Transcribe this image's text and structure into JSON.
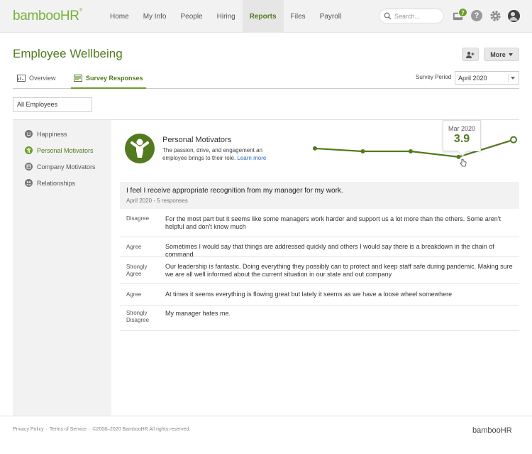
{
  "header": {
    "logo": "bambooHR",
    "nav": [
      "Home",
      "My Info",
      "People",
      "Hiring",
      "Reports",
      "Files",
      "Payroll"
    ],
    "active_nav": "Reports",
    "search_placeholder": "Search...",
    "inbox_count": "7",
    "help_label": "?"
  },
  "page": {
    "title": "Employee Wellbeing",
    "more_label": "More",
    "tabs": [
      {
        "label": "Overview",
        "icon": "chart-icon"
      },
      {
        "label": "Survey Responses",
        "icon": "survey-icon"
      }
    ],
    "active_tab": "Survey Responses",
    "period_label": "Survey Period",
    "period_value": "April 2020",
    "employee_filter": "All Employees"
  },
  "sidebar": {
    "items": [
      {
        "label": "Happiness",
        "icon": "smile-icon"
      },
      {
        "label": "Personal Motivators",
        "icon": "motivator-icon"
      },
      {
        "label": "Company Motivators",
        "icon": "building-icon"
      },
      {
        "label": "Relationships",
        "icon": "people-icon"
      }
    ],
    "active": "Personal Motivators"
  },
  "motivator": {
    "title": "Personal Motivators",
    "description": "The passion, drive, and engagement an employee brings to their role.",
    "link": "Learn more",
    "tooltip_date": "Mar 2020",
    "tooltip_value": "3.9",
    "trend_level": [
      0.62,
      0.5,
      0.5,
      0.27,
      0.98
    ]
  },
  "question": {
    "text": "I feel I receive appropriate recognition from my manager for my work.",
    "meta": "April 2020 - 5 responses"
  },
  "responses": [
    {
      "rating": "Disagree",
      "text": "For the most part but it seems like some managers work harder and support us a lot more than the others. Some aren't helpful and don't know much"
    },
    {
      "rating": "Agree",
      "text": "Sometimes I would say that things are addressed quickly and others I would say there is a breakdown in the chain of command"
    },
    {
      "rating": "Strongly Agree",
      "text": "Our leadership is fantastic. Doing everything they possibly can to protect and keep staff safe during pandemic. Making sure we are all well informed about the current situation in our state and out company"
    },
    {
      "rating": "Agree",
      "text": "At times it seems everything is flowing great but lately it seems as we have a loose wheel somewhere"
    },
    {
      "rating": "Strongly Disagree",
      "text": "My manager hates me."
    }
  ],
  "footer": {
    "privacy": "Privacy Policy",
    "sep1": "·",
    "terms": "Terms of Service",
    "sep2": "·",
    "copyright": "©2008–2020 BambooHR All rights reserved.",
    "logo": "bambooHR"
  },
  "colors": {
    "brand": "#527a1e",
    "accent": "#6b9e2a",
    "logo": "#73b23a"
  }
}
